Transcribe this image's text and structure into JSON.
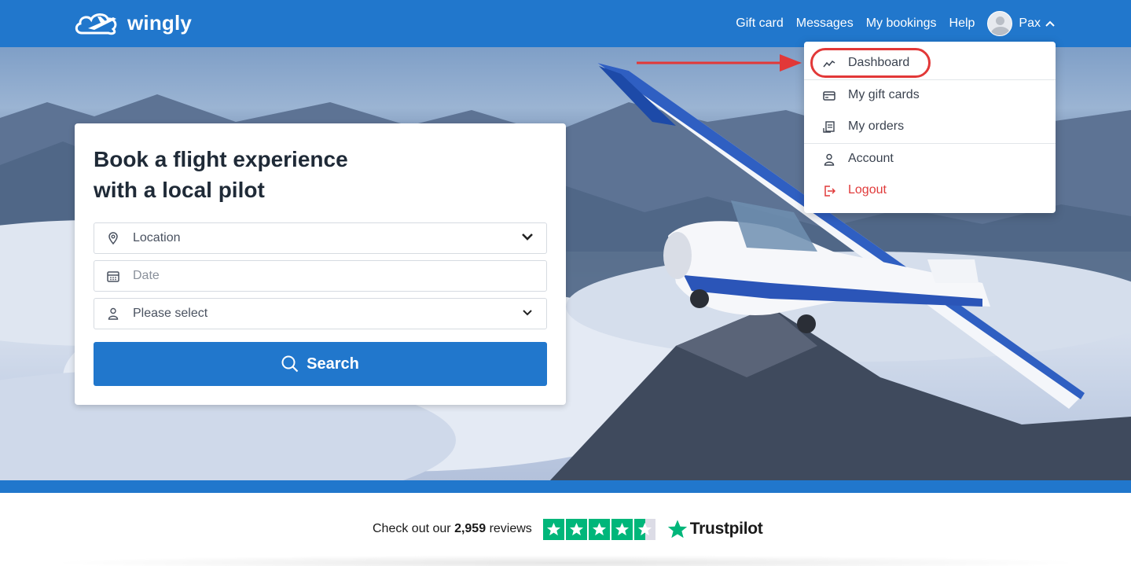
{
  "header": {
    "logo_text": "wingly",
    "nav": [
      "Gift card",
      "Messages",
      "My bookings",
      "Help"
    ],
    "user_name": "Pax"
  },
  "search_card": {
    "title_line1": "Book a flight experience",
    "title_line2": "with a local pilot",
    "location_placeholder": "Location",
    "date_placeholder": "Date",
    "passengers_value": "Please select",
    "search_label": "Search"
  },
  "user_menu": {
    "items": [
      {
        "label": "Dashboard",
        "icon": "trend-icon"
      },
      {
        "label": "My gift cards",
        "icon": "card-icon"
      },
      {
        "label": "My orders",
        "icon": "receipt-icon"
      },
      {
        "label": "Account",
        "icon": "person-icon"
      },
      {
        "label": "Logout",
        "icon": "logout-icon"
      }
    ]
  },
  "reviews": {
    "prefix": "Check out our",
    "count": "2,959",
    "suffix": "reviews",
    "brand": "Trustpilot",
    "rating_stars": 4.5
  },
  "colors": {
    "brand_blue": "#2177cc",
    "highlight_red": "#e23838",
    "logout_red": "#e03a3a",
    "trustpilot_green": "#00b67a"
  }
}
